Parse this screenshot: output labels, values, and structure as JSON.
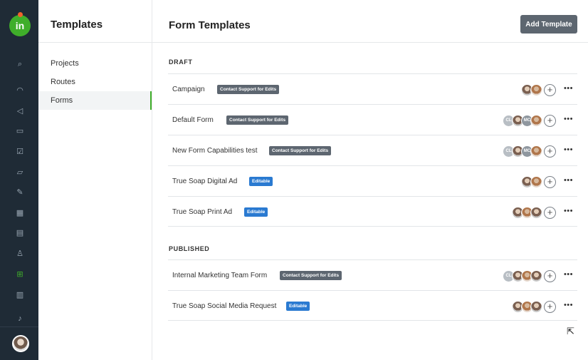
{
  "rail": {
    "logo_text": "in",
    "icons": [
      "search-icon",
      "dashboard-icon",
      "megaphone-icon",
      "folder-icon",
      "check-square-icon",
      "inbox-icon",
      "edit-doc-icon",
      "calendar-icon",
      "clipboard-icon",
      "person-icon",
      "templates-icon",
      "chart-icon",
      "bell-icon"
    ]
  },
  "nav": {
    "header": "Templates",
    "items": [
      {
        "label": "Projects"
      },
      {
        "label": "Routes"
      },
      {
        "label": "Forms",
        "active": true
      }
    ]
  },
  "main": {
    "title": "Form Templates",
    "add_button": "Add Template",
    "sections": [
      {
        "label": "DRAFT",
        "rows": [
          {
            "name": "Campaign",
            "badge": "Contact Support for Edits",
            "badge_type": "grey",
            "avatars": [
              "photo",
              "photo2"
            ]
          },
          {
            "name": "Default Form",
            "badge": "Contact Support for Edits",
            "badge_type": "grey",
            "avatars": [
              "CL",
              "photo",
              "MC",
              "photo2"
            ]
          },
          {
            "name": "New Form Capabilities test",
            "badge": "Contact Support for Edits",
            "badge_type": "grey",
            "avatars": [
              "CL",
              "photo",
              "MC",
              "photo2"
            ]
          },
          {
            "name": "True Soap Digital Ad",
            "badge": "Editable",
            "badge_type": "blue",
            "avatars": [
              "photo",
              "photo2"
            ]
          },
          {
            "name": "True Soap Print Ad",
            "badge": "Editable",
            "badge_type": "blue",
            "avatars": [
              "photo",
              "photo2",
              "photo"
            ]
          }
        ]
      },
      {
        "label": "PUBLISHED",
        "rows": [
          {
            "name": "Internal Marketing Team Form",
            "badge": "Contact Support for Edits",
            "badge_type": "grey",
            "avatars": [
              "CL",
              "photo",
              "photo2",
              "photo"
            ]
          },
          {
            "name": "True Soap Social Media Request",
            "badge": "Editable",
            "badge_type": "blue",
            "avatars": [
              "photo",
              "photo2",
              "photo"
            ]
          }
        ]
      }
    ]
  },
  "colors": {
    "rail_bg": "#1f2b36",
    "accent": "#3fae2a",
    "grey_badge": "#5d6670",
    "blue_badge": "#2a7ad1"
  }
}
